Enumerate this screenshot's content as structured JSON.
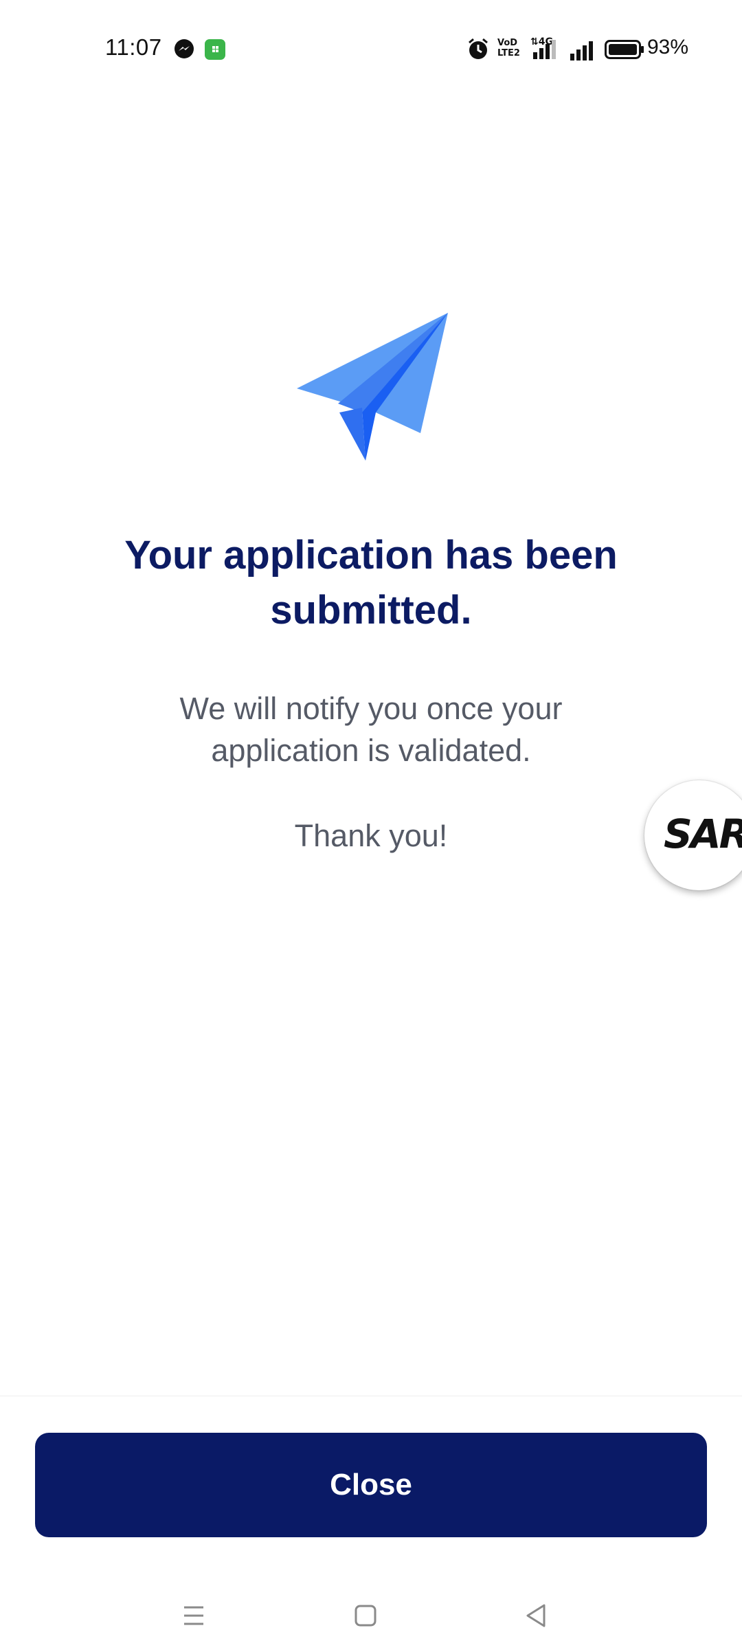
{
  "status_bar": {
    "time": "11:07",
    "battery": "93%",
    "network_label": "4G",
    "volte_label": "VoD LTE2",
    "icons": [
      "messenger-icon",
      "app-notification-icon",
      "alarm-icon",
      "volte-icon",
      "signal-4g-icon",
      "signal-icon",
      "battery-icon"
    ]
  },
  "main": {
    "icon": "paper-plane-icon",
    "title": "Your application has been submitted.",
    "message": "We will notify you once your application is validated.",
    "thanks": "Thank you!"
  },
  "floating_badge": {
    "label": "SAR"
  },
  "footer": {
    "close_label": "Close"
  },
  "nav_bar": {
    "items": [
      "menu-icon",
      "home-icon",
      "back-icon"
    ]
  },
  "colors": {
    "primary": "#0a1a66",
    "title": "#0c1b63",
    "body_text": "#555a66",
    "plane_light": "#5b9cf5",
    "plane_dark": "#1a5ff2"
  }
}
